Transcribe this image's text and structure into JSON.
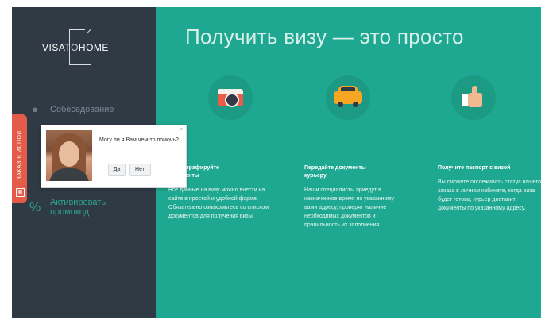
{
  "logo": {
    "visa": "VISA",
    "to": "TO",
    "home": "HOME"
  },
  "sidebar": {
    "items": [
      {
        "label": "Собеседование",
        "icon": "bulb-icon"
      },
      {
        "label": "Активировать",
        "sub": "промокод",
        "icon": "percent-icon"
      }
    ],
    "tab_label": "ЗАКАЗ В ИСПОЛ",
    "tab_icon": "grid-icon"
  },
  "popup": {
    "question": "Могу ли я Вам чем-то помочь?",
    "yes": "Да",
    "no": "Нет",
    "close": "×"
  },
  "main": {
    "headline": "Получить визу — это просто",
    "columns": [
      {
        "icon": "camera-icon",
        "title": "Сфотографируйте документы",
        "text": "Все данные на визу можно внести на сайте в простой и удобной форме. Обязательно ознакомьтесь со списком документов для получения визы."
      },
      {
        "icon": "car-icon",
        "title": "Передайте документы курьеру",
        "text": "Наши специалисты приедут в назначенное время по указанному вами адресу, проверят наличие необходимых документов и правильность их заполнения."
      },
      {
        "icon": "thumbs-up-icon",
        "title": "Получите паспорт с визой",
        "text": "Вы сможете отслеживать статус вашего заказа в личном кабинете, когда виза будет готова, курьер доставит документы по указанному адресу."
      }
    ]
  },
  "colors": {
    "sidebar": "#2f3a45",
    "main": "#1fa891",
    "accent": "#e45b4a",
    "green": "#2aa58e"
  }
}
